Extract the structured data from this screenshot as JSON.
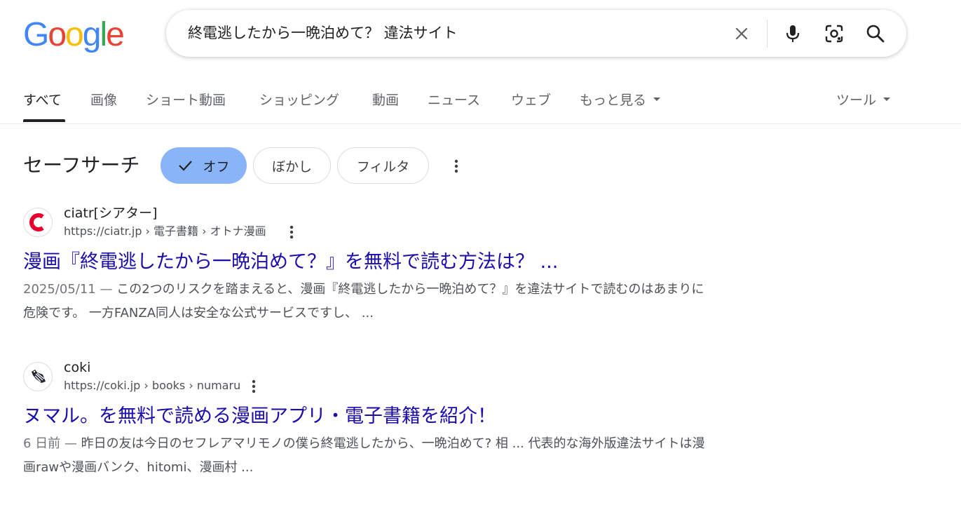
{
  "header": {
    "logo_letters": [
      "G",
      "o",
      "o",
      "g",
      "l",
      "e"
    ],
    "logo_colors": [
      "#4285F4",
      "#EA4335",
      "#FBBC05",
      "#4285F4",
      "#34A853",
      "#EA4335"
    ],
    "query": "終電逃したから一晩泊めて？ 違法サイト"
  },
  "tabs": [
    {
      "label": "すべて"
    },
    {
      "label": "画像"
    },
    {
      "label": "ショート動画"
    },
    {
      "label": "ショッピング"
    },
    {
      "label": "動画"
    },
    {
      "label": "ニュース"
    },
    {
      "label": "ウェブ"
    },
    {
      "label": "もっと見る"
    },
    {
      "label": "ツール"
    }
  ],
  "safesearch": {
    "title": "セーフサーチ",
    "options": [
      {
        "label": "オフ",
        "selected": true
      },
      {
        "label": "ぼかし",
        "selected": false
      },
      {
        "label": "フィルタ",
        "selected": false
      }
    ]
  },
  "results": [
    {
      "site_name": "ciatr[シアター]",
      "url": "https://ciatr.jp › 電子書籍 › オトナ漫画",
      "title": "漫画『終電逃したから一晩泊めて？』を無料で読む方法は？ ...",
      "date": "2025/05/11 — ",
      "snippet": "この2つのリスクを踏まえると、漫画『終電逃したから一晩泊めて？』を違法サイトで読むのはあまりに危険です。 一方FANZA同人は安全な公式サービスですし、 ..."
    },
    {
      "site_name": "coki",
      "url": "https://coki.jp › books › numaru",
      "title": "ヌマル。を無料で読める漫画アプリ・電子書籍を紹介！",
      "date": "6 日前 — ",
      "snippet": "昨日の友は今日のセフレアマリモノの僕ら終電逃したから、一晩泊めて? 相 ... 代表的な海外版違法サイトは漫画rawや漫画バンク、hitomi、漫画村 ..."
    }
  ],
  "colors": {
    "link": "#1a0dab",
    "chip_selected": "#8ab4f8",
    "ciatr_brand": "#e5002d"
  }
}
